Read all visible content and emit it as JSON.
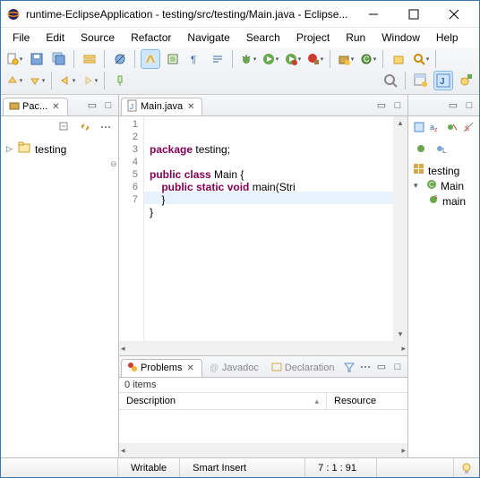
{
  "window": {
    "title": "runtime-EclipseApplication - testing/src/testing/Main.java - Eclipse..."
  },
  "menu": [
    "File",
    "Edit",
    "Source",
    "Refactor",
    "Navigate",
    "Search",
    "Project",
    "Run",
    "Window",
    "Help"
  ],
  "package_explorer": {
    "tab_label": "Pac...",
    "project": "testing"
  },
  "editor": {
    "tab_label": "Main.java",
    "lines": [
      "1",
      "2",
      "3",
      "4",
      "5",
      "6",
      "7"
    ],
    "code": {
      "l1_kw": "package",
      "l1_rest": " testing;",
      "l3_kw1": "public",
      "l3_kw2": "class",
      "l3_name": " Main {",
      "l4_kw": "public static void",
      "l4_rest": " main(Stri",
      "l5": "    }",
      "l6": "}"
    }
  },
  "outline": {
    "pkg": "testing",
    "class": "Main",
    "method": "main"
  },
  "problems": {
    "tab1": "Problems",
    "tab2": "Javadoc",
    "tab3": "Declaration",
    "items_text": "0 items",
    "col_description": "Description",
    "col_resource": "Resource"
  },
  "status": {
    "writable": "Writable",
    "insert": "Smart Insert",
    "pos": "7 : 1 : 91"
  }
}
